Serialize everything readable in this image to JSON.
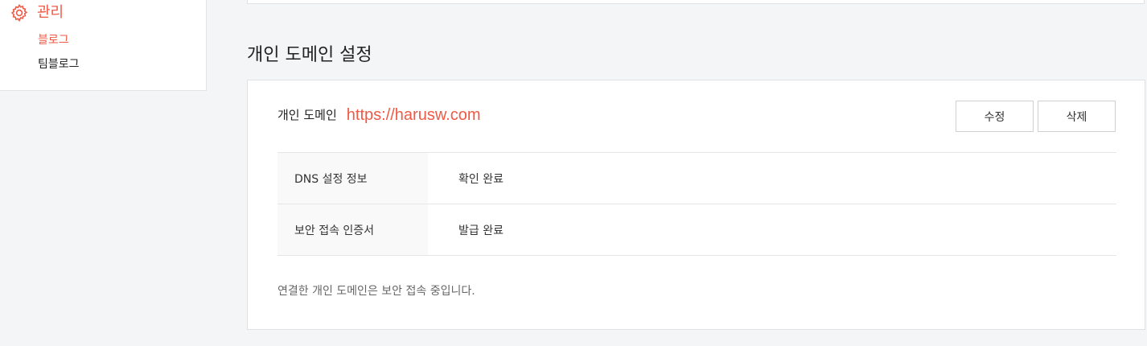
{
  "sidebar": {
    "section": {
      "label": "관리",
      "icon": "gear-icon"
    },
    "items": [
      {
        "label": "블로그",
        "active": true
      },
      {
        "label": "팀블로그",
        "active": false
      }
    ]
  },
  "main": {
    "section_title": "개인 도메인 설정",
    "domain": {
      "label": "개인 도메인",
      "value": "https://harusw.com"
    },
    "buttons": {
      "edit": "수정",
      "delete": "삭제"
    },
    "info_rows": [
      {
        "label": "DNS 설정 정보",
        "value": "확인 완료"
      },
      {
        "label": "보안 접속 인증서",
        "value": "발급 완료"
      }
    ],
    "footer_note": "연결한 개인 도메인은 보안 접속 중입니다."
  },
  "colors": {
    "accent": "#ef5a46",
    "background": "#f4f5f7"
  }
}
